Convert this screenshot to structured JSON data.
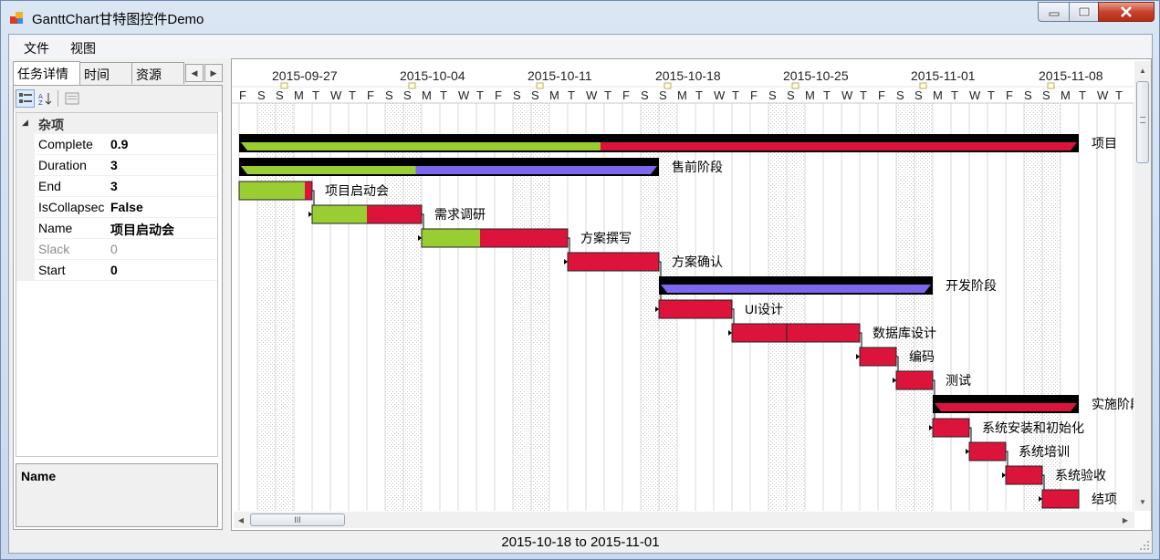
{
  "window": {
    "title": "GanttChart甘特图控件Demo"
  },
  "menu": {
    "items": [
      "文件",
      "视图"
    ]
  },
  "left_panel": {
    "tabs": [
      "任务详情",
      "时间",
      "资源"
    ],
    "property_grid": {
      "category": "杂项",
      "rows": [
        {
          "name": "Complete",
          "value": "0.9",
          "dim": false
        },
        {
          "name": "Duration",
          "value": "3",
          "dim": false
        },
        {
          "name": "End",
          "value": "3",
          "dim": false
        },
        {
          "name": "IsCollapsec",
          "value": "False",
          "dim": false
        },
        {
          "name": "Name",
          "value": "项目启动会",
          "dim": false
        },
        {
          "name": "Slack",
          "value": "0",
          "dim": true
        },
        {
          "name": "Start",
          "value": "0",
          "dim": false
        }
      ],
      "help_title": "Name"
    }
  },
  "gantt": {
    "week_labels": [
      "2015-09-27",
      "2015-10-04",
      "2015-10-11",
      "2015-10-18",
      "2015-10-25",
      "2015-11-01",
      "2015-11-08"
    ],
    "day_letters": [
      "F",
      "S",
      "S",
      "M",
      "T",
      "W",
      "T",
      "F",
      "S",
      "S",
      "M",
      "T",
      "W",
      "T",
      "F",
      "S",
      "S",
      "M",
      "T",
      "W",
      "T",
      "F",
      "S",
      "S",
      "M",
      "T",
      "W",
      "T",
      "F",
      "S",
      "S",
      "M",
      "T",
      "W",
      "T",
      "F",
      "S",
      "S",
      "M",
      "T",
      "W",
      "T",
      "F",
      "S",
      "S",
      "M",
      "T",
      "W",
      "T",
      "F"
    ],
    "colors": {
      "summary": "#000000",
      "complete_green": "#9acd32",
      "task_red": "#dc143c",
      "purple": "#7b68ee",
      "weekend_hatch": "#c8c8c8"
    },
    "tasks": [
      {
        "name": "项目",
        "start": 0,
        "end": 45,
        "complete": 0.43,
        "summary": true,
        "fill": "red"
      },
      {
        "name": "售前阶段",
        "start": 0,
        "end": 22,
        "complete": 0.42,
        "summary": true,
        "fill": "purple"
      },
      {
        "name": "项目启动会",
        "start": 0,
        "end": 3,
        "complete": 0.9,
        "summary": false
      },
      {
        "name": "需求调研",
        "start": 4,
        "end": 9,
        "complete": 0.5,
        "summary": false
      },
      {
        "name": "方案撰写",
        "start": 10,
        "end": 17,
        "complete": 0.4,
        "summary": false
      },
      {
        "name": "方案确认",
        "start": 18,
        "end": 22,
        "complete": 0,
        "summary": false
      },
      {
        "name": "开发阶段",
        "start": 23,
        "end": 37,
        "complete": 0,
        "summary": true,
        "fill": "purple"
      },
      {
        "name": "UI设计",
        "start": 23,
        "end": 26,
        "complete": 0,
        "summary": false
      },
      {
        "name": "数据库设计",
        "start": 27,
        "end": 33,
        "complete": 0,
        "summary": false,
        "split": [
          [
            27,
            29
          ],
          [
            30,
            33
          ]
        ]
      },
      {
        "name": "编码",
        "start": 34,
        "end": 35,
        "complete": 0,
        "summary": false
      },
      {
        "name": "测试",
        "start": 36,
        "end": 37,
        "complete": 0,
        "summary": false
      },
      {
        "name": "实施阶段",
        "start": 38,
        "end": 45,
        "complete": 0,
        "summary": true,
        "fill": "red"
      },
      {
        "name": "系统安装和初始化",
        "start": 38,
        "end": 39,
        "complete": 0,
        "summary": false
      },
      {
        "name": "系统培训",
        "start": 40,
        "end": 41,
        "complete": 0,
        "summary": false
      },
      {
        "name": "系统验收",
        "start": 42,
        "end": 43,
        "complete": 0,
        "summary": false
      },
      {
        "name": "结项",
        "start": 44,
        "end": 45,
        "complete": 0,
        "summary": false
      }
    ],
    "dependencies": [
      [
        2,
        3
      ],
      [
        3,
        4
      ],
      [
        4,
        5
      ],
      [
        5,
        7
      ],
      [
        7,
        8
      ],
      [
        8,
        9
      ],
      [
        9,
        10
      ],
      [
        10,
        12
      ],
      [
        12,
        13
      ],
      [
        13,
        14
      ],
      [
        14,
        15
      ]
    ]
  },
  "status": {
    "text": "2015-10-18 to 2015-11-01"
  }
}
